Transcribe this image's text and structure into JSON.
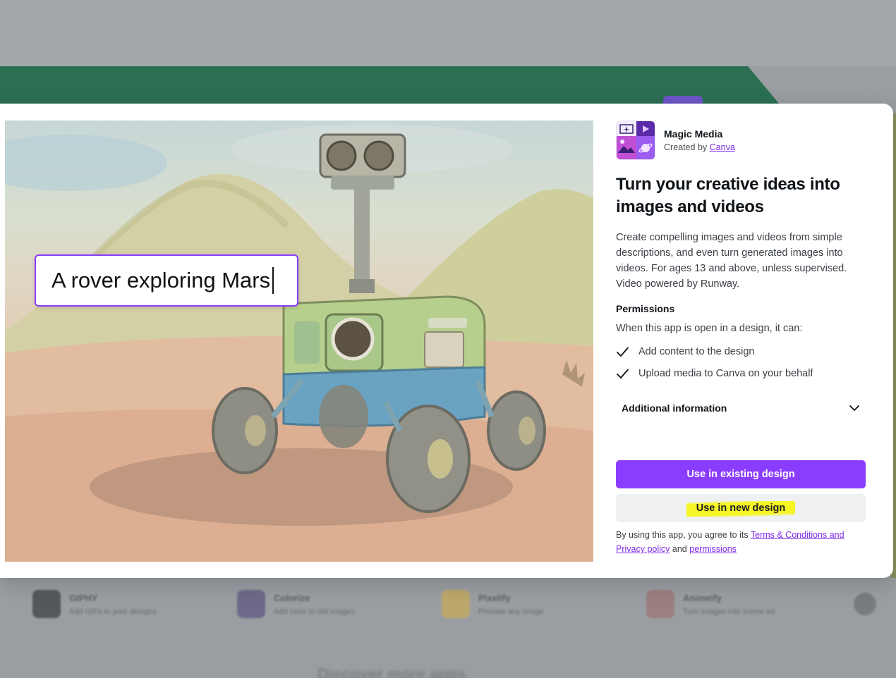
{
  "background": {
    "apps": [
      {
        "name": "GIPHY",
        "desc": "Add GIFs to your designs",
        "color": "#1b1e22"
      },
      {
        "name": "Colorize",
        "desc": "Add color to old images",
        "color": "#4b3f73"
      },
      {
        "name": "Pixelify",
        "desc": "Pixelate any image",
        "color": "#d9b040"
      },
      {
        "name": "Animeify",
        "desc": "Turn images into anime art",
        "color": "#9a6860"
      }
    ],
    "bottom_heading": "Discover more apps"
  },
  "hero": {
    "prompt_text": "A rover exploring Mars"
  },
  "app": {
    "logo_icon": "magic-media-logo",
    "name": "Magic Media",
    "created_by_prefix": "Created by",
    "creator_link": "Canva"
  },
  "headline": "Turn your creative ideas into images and videos",
  "description": "Create compelling images and videos from simple descriptions, and even turn generated images into videos. For ages 13 and above, unless supervised. Video powered by Runway.",
  "permissions": {
    "title": "Permissions",
    "intro": "When this app is open in a design, it can:",
    "items": [
      "Add content to the design",
      "Upload media to Canva on your behalf"
    ]
  },
  "additional_info": {
    "label": "Additional information",
    "icon": "chevron-down-icon"
  },
  "buttons": {
    "existing": "Use in existing design",
    "new": "Use in new design"
  },
  "terms": {
    "prefix": "By using this app, you agree to its",
    "terms_link": "Terms & Conditions and Privacy policy",
    "and": "and",
    "permissions_link": "permissions"
  },
  "colors": {
    "accent": "#8b3dff",
    "highlight": "#f6f526",
    "link": "#7d2ae8"
  }
}
